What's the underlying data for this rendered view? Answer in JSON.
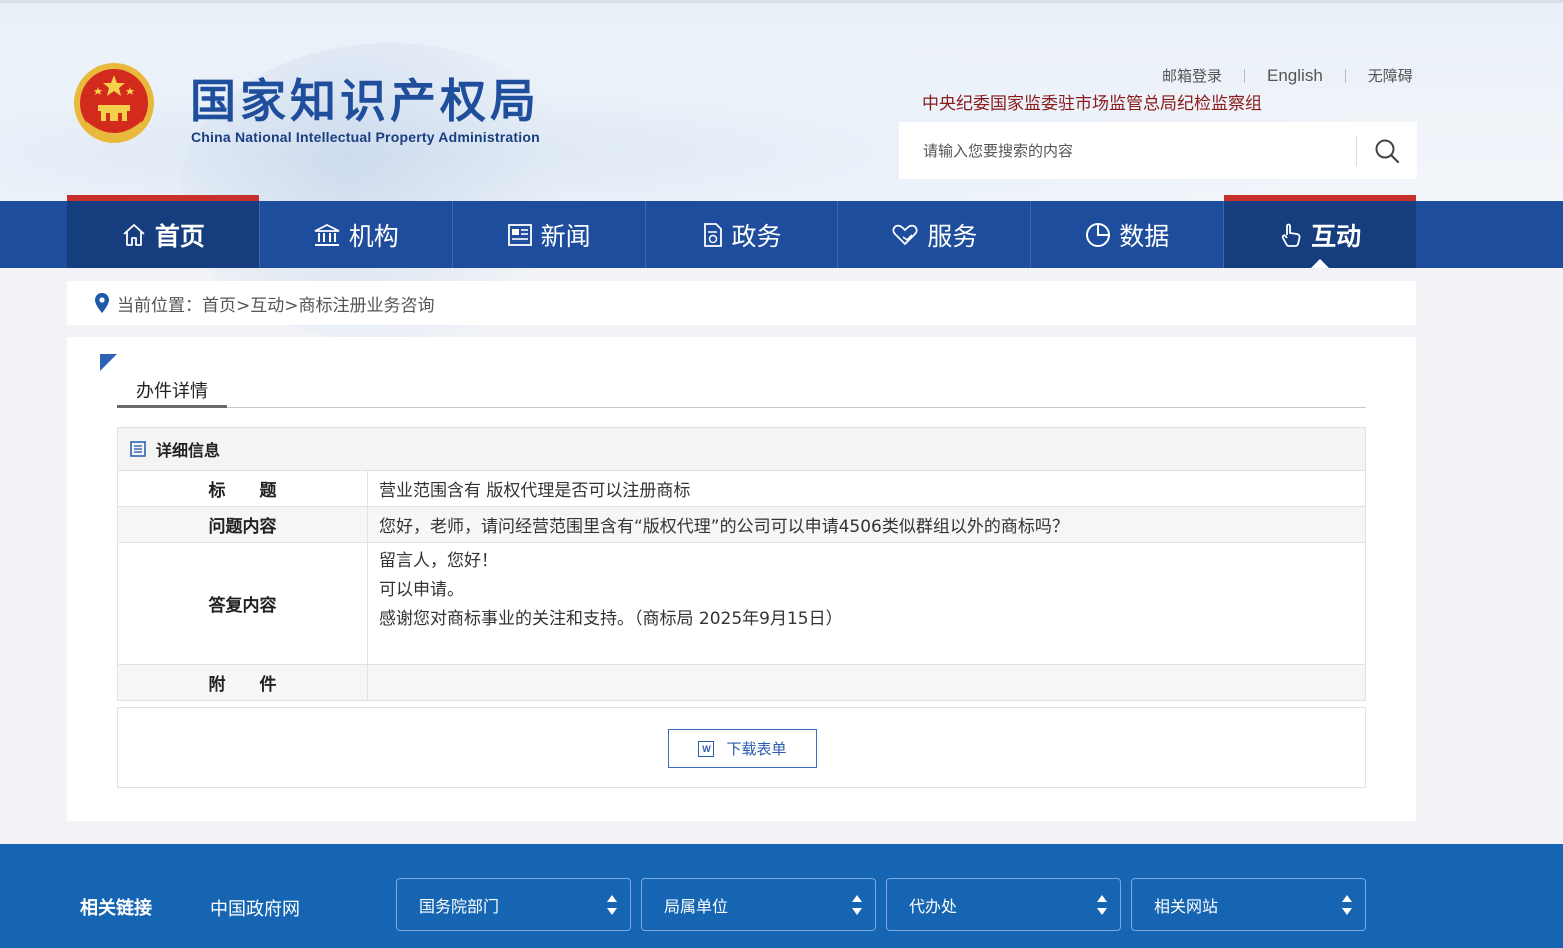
{
  "header": {
    "title": "国家知识产权局",
    "subtitle": "China National Intellectual Property Administration",
    "top_links": [
      "邮箱登录",
      "English",
      "无障碍"
    ],
    "discipline_link": "中央纪委国家监委驻市场监管总局纪检监察组",
    "search": {
      "placeholder": "请输入您要搜索的内容"
    }
  },
  "nav": {
    "items": [
      {
        "label": "首页",
        "icon": "home-icon"
      },
      {
        "label": "机构",
        "icon": "institution-icon"
      },
      {
        "label": "新闻",
        "icon": "news-icon"
      },
      {
        "label": "政务",
        "icon": "document-icon"
      },
      {
        "label": "服务",
        "icon": "heart-hand-icon"
      },
      {
        "label": "数据",
        "icon": "pie-chart-icon"
      },
      {
        "label": "互动",
        "icon": "pointer-hand-icon"
      }
    ],
    "active_index": 6
  },
  "breadcrumb": {
    "text": "当前位置：首页>互动>商标注册业务咨询"
  },
  "content": {
    "tab_title": "办件详情",
    "section_title": "详细信息",
    "rows": {
      "title_label": "标　　题",
      "title_value": "营业范围含有 版权代理是否可以注册商标",
      "question_label": "问题内容",
      "question_value": "您好，老师，请问经营范围里含有“版权代理”的公司可以申请4506类似群组以外的商标吗？",
      "answer_label": "答复内容",
      "answer_lines": [
        "留言人，您好！",
        "可以申请。",
        "感谢您对商标事业的关注和支持。（商标局 2025年9月15日）"
      ],
      "attachment_label": "附　　件",
      "attachment_value": ""
    },
    "download_label": "下载表单"
  },
  "footer": {
    "label": "相关链接",
    "gov_link": "中国政府网",
    "selects": [
      "国务院部门",
      "局属单位",
      "代办处",
      "相关网站"
    ]
  },
  "colors": {
    "nav_bg": "#1d4d9c",
    "nav_active": "#163d7d",
    "footer_bg": "#1565b3",
    "discipline_text": "#8a1b1b"
  }
}
